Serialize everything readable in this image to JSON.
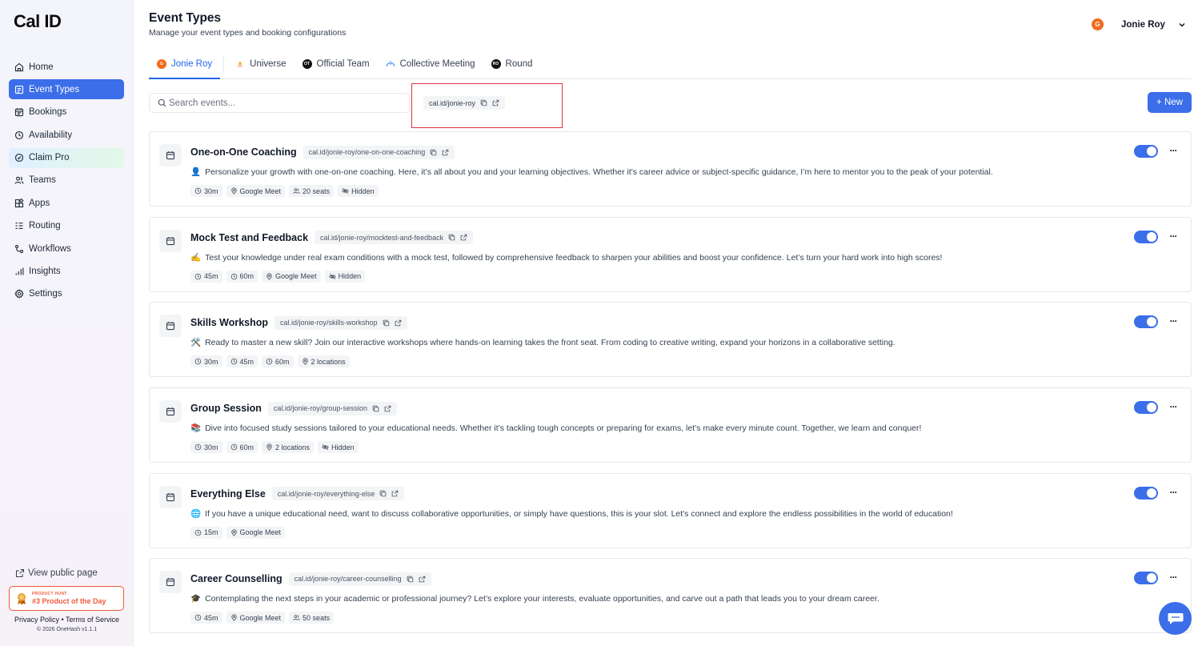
{
  "app": {
    "logo": "Cal ID"
  },
  "sidebar": {
    "items": [
      {
        "label": "Home",
        "icon": "home-icon"
      },
      {
        "label": "Event Types",
        "icon": "event-types-icon",
        "active": true
      },
      {
        "label": "Bookings",
        "icon": "calendar-icon"
      },
      {
        "label": "Availability",
        "icon": "clock-icon"
      },
      {
        "label": "Claim Pro",
        "icon": "claim-pro-icon"
      },
      {
        "label": "Teams",
        "icon": "users-icon"
      },
      {
        "label": "Apps",
        "icon": "apps-icon"
      },
      {
        "label": "Routing",
        "icon": "routing-icon"
      },
      {
        "label": "Workflows",
        "icon": "workflows-icon"
      },
      {
        "label": "Insights",
        "icon": "insights-icon"
      },
      {
        "label": "Settings",
        "icon": "gear-icon"
      }
    ],
    "view_public_page": "View public page",
    "product_hunt": {
      "small": "PRODUCT HUNT",
      "big": "#3 Product of the Day"
    },
    "legal": "Privacy Policy • Terms of Service",
    "copyright": "© 2026 OneHash v1.1.1"
  },
  "header": {
    "title": "Event Types",
    "subtitle": "Manage your event types and booking configurations",
    "user": {
      "initial": "G",
      "name": "Jonie Roy"
    }
  },
  "tabs": [
    {
      "label": "Jonie Roy",
      "badge": "G",
      "color": "#f26b1d",
      "active": true
    },
    {
      "label": "Universe",
      "badge": "",
      "color": "#ffffff"
    },
    {
      "label": "Official Team",
      "badge": "OT",
      "color": "#111111"
    },
    {
      "label": "Collective Meeting",
      "badge": "",
      "color": "#ffffff"
    },
    {
      "label": "Round",
      "badge": "RO",
      "color": "#111111"
    }
  ],
  "search": {
    "placeholder": "Search events...",
    "value": ""
  },
  "profile_link": "cal.id/jonie-roy",
  "new_button": "+ New",
  "events": [
    {
      "title": "One-on-One Coaching",
      "link": "cal.id/jonie-roy/one-on-one-coaching",
      "emoji": "👤",
      "description": "Personalize your growth with one-on-one coaching. Here, it’s all about you and your learning objectives. Whether it's career advice or subject-specific guidance, I’m here to mentor you to the peak of your potential.",
      "tags": [
        {
          "label": "30m",
          "icon": "clock"
        },
        {
          "label": "Google Meet",
          "icon": "location"
        },
        {
          "label": "20 seats",
          "icon": "users"
        },
        {
          "label": "Hidden",
          "icon": "eye-off"
        }
      ],
      "enabled": true
    },
    {
      "title": "Mock Test and Feedback",
      "link": "cal.id/jonie-roy/mocktest-and-feedback",
      "emoji": "✍️",
      "description": "Test your knowledge under real exam conditions with a mock test, followed by comprehensive feedback to sharpen your abilities and boost your confidence. Let’s turn your hard work into high scores!",
      "tags": [
        {
          "label": "45m",
          "icon": "clock"
        },
        {
          "label": "60m",
          "icon": "clock"
        },
        {
          "label": "Google Meet",
          "icon": "location"
        },
        {
          "label": "Hidden",
          "icon": "eye-off"
        }
      ],
      "enabled": true
    },
    {
      "title": "Skills Workshop",
      "link": "cal.id/jonie-roy/skills-workshop",
      "emoji": "🛠️",
      "description": "Ready to master a new skill? Join our interactive workshops where hands-on learning takes the front seat. From coding to creative writing, expand your horizons in a collaborative setting.",
      "tags": [
        {
          "label": "30m",
          "icon": "clock"
        },
        {
          "label": "45m",
          "icon": "clock"
        },
        {
          "label": "60m",
          "icon": "clock"
        },
        {
          "label": "2 locations",
          "icon": "location"
        }
      ],
      "enabled": true
    },
    {
      "title": "Group Session",
      "link": "cal.id/jonie-roy/group-session",
      "emoji": "📚",
      "description": "Dive into focused study sessions tailored to your educational needs. Whether it’s tackling tough concepts or preparing for exams, let’s make every minute count. Together, we learn and conquer!",
      "tags": [
        {
          "label": "30m",
          "icon": "clock"
        },
        {
          "label": "60m",
          "icon": "clock"
        },
        {
          "label": "2 locations",
          "icon": "location"
        },
        {
          "label": "Hidden",
          "icon": "eye-off"
        }
      ],
      "enabled": true
    },
    {
      "title": "Everything Else",
      "link": "cal.id/jonie-roy/everything-else",
      "emoji": "🌐",
      "description": "If you have a unique educational need, want to discuss collaborative opportunities, or simply have questions, this is your slot. Let's connect and explore the endless possibilities in the world of education!",
      "tags": [
        {
          "label": "15m",
          "icon": "clock"
        },
        {
          "label": "Google Meet",
          "icon": "location"
        }
      ],
      "enabled": true
    },
    {
      "title": "Career Counselling",
      "link": "cal.id/jonie-roy/career-counselling",
      "emoji": "🎓",
      "description": "Contemplating the next steps in your academic or professional journey? Let’s explore your interests, evaluate opportunities, and carve out a path that leads you to your dream career.",
      "tags": [
        {
          "label": "45m",
          "icon": "clock"
        },
        {
          "label": "Google Meet",
          "icon": "location"
        },
        {
          "label": "50 seats",
          "icon": "users"
        }
      ],
      "enabled": true
    }
  ],
  "colors": {
    "accent": "#3b6ee8",
    "highlight_box": "#e0343f",
    "product_hunt": "#ef5a3c"
  }
}
